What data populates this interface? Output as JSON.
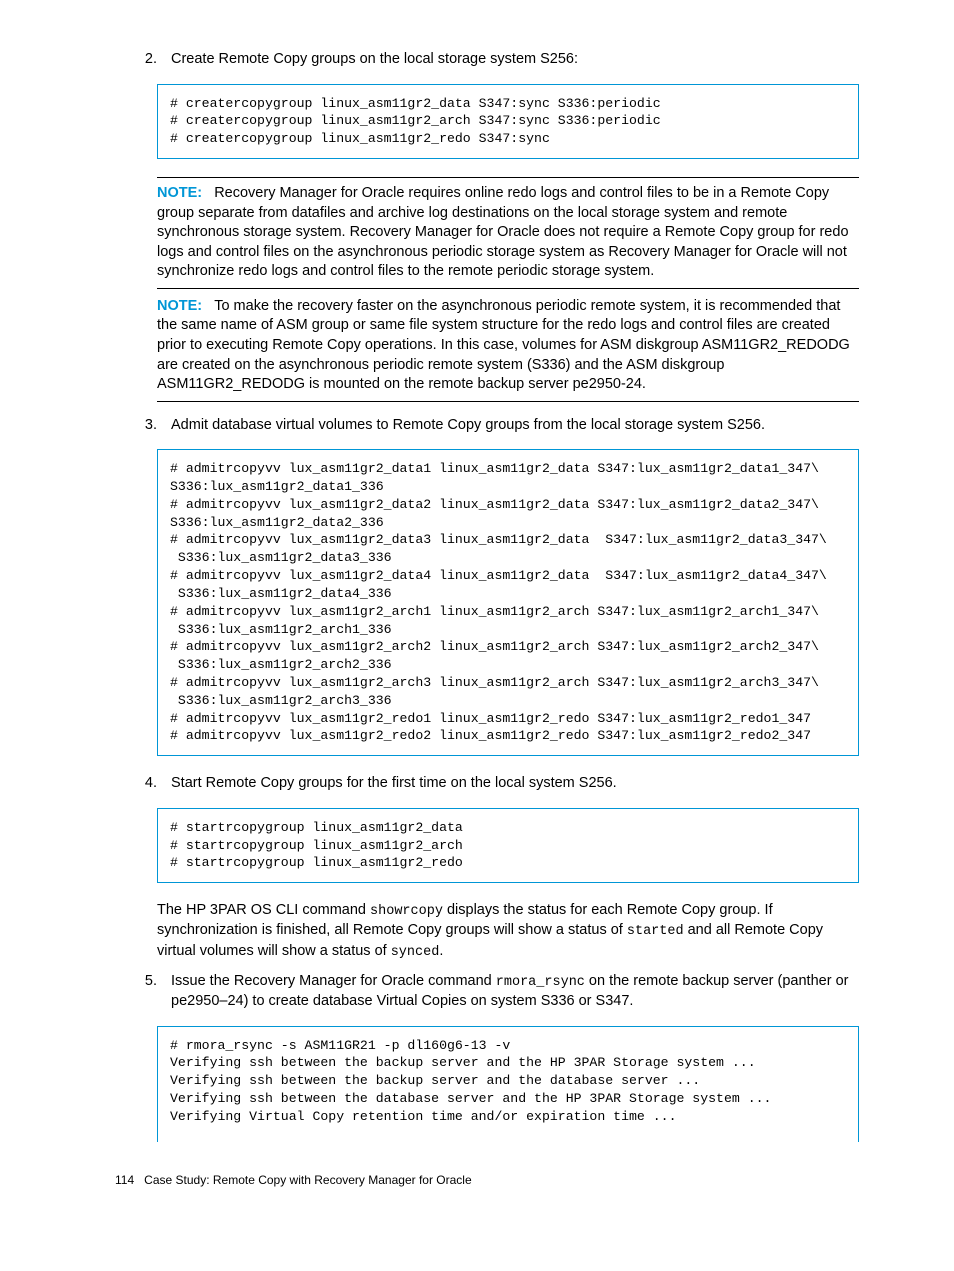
{
  "steps": {
    "s2": {
      "num": "2.",
      "text": "Create Remote Copy groups on the local storage system S256:"
    },
    "s3": {
      "num": "3.",
      "text": "Admit database virtual volumes to Remote Copy groups from the local storage system S256."
    },
    "s4": {
      "num": "4.",
      "text": "Start Remote Copy groups for the first time on the local system S256."
    },
    "s5": {
      "num": "5.",
      "text_a": "Issue the Recovery Manager for Oracle command ",
      "code_a": "rmora_rsync",
      "text_b": " on the remote backup server (panther or pe2950–24) to create database Virtual Copies on system S336 or S347."
    }
  },
  "code1": "# creatercopygroup linux_asm11gr2_data S347:sync S336:periodic\n# creatercopygroup linux_asm11gr2_arch S347:sync S336:periodic\n# creatercopygroup linux_asm11gr2_redo S347:sync",
  "note1": {
    "label": "NOTE:",
    "text": "Recovery Manager for Oracle requires online redo logs and control files to be in a Remote Copy group separate from datafiles and archive log destinations on the local storage system and remote synchronous storage system. Recovery Manager for Oracle does not require a Remote Copy group for redo logs and control files on the asynchronous periodic storage system as Recovery Manager for Oracle will not synchronize redo logs and control files to the remote periodic storage system."
  },
  "note2": {
    "label": "NOTE:",
    "text": "To make the recovery faster on the asynchronous periodic remote system, it is recommended that the same name of ASM group or same file system structure for the redo logs and control files are created prior to executing Remote Copy operations. In this case, volumes for ASM diskgroup ASM11GR2_REDODG are created on the asynchronous periodic remote system (S336) and the ASM diskgroup ASM11GR2_REDODG is mounted on the remote backup server pe2950-24."
  },
  "code2": "# admitrcopyvv lux_asm11gr2_data1 linux_asm11gr2_data S347:lux_asm11gr2_data1_347\\\nS336:lux_asm11gr2_data1_336\n# admitrcopyvv lux_asm11gr2_data2 linux_asm11gr2_data S347:lux_asm11gr2_data2_347\\\nS336:lux_asm11gr2_data2_336\n# admitrcopyvv lux_asm11gr2_data3 linux_asm11gr2_data  S347:lux_asm11gr2_data3_347\\\n S336:lux_asm11gr2_data3_336\n# admitrcopyvv lux_asm11gr2_data4 linux_asm11gr2_data  S347:lux_asm11gr2_data4_347\\\n S336:lux_asm11gr2_data4_336\n# admitrcopyvv lux_asm11gr2_arch1 linux_asm11gr2_arch S347:lux_asm11gr2_arch1_347\\\n S336:lux_asm11gr2_arch1_336\n# admitrcopyvv lux_asm11gr2_arch2 linux_asm11gr2_arch S347:lux_asm11gr2_arch2_347\\\n S336:lux_asm11gr2_arch2_336\n# admitrcopyvv lux_asm11gr2_arch3 linux_asm11gr2_arch S347:lux_asm11gr2_arch3_347\\\n S336:lux_asm11gr2_arch3_336\n# admitrcopyvv lux_asm11gr2_redo1 linux_asm11gr2_redo S347:lux_asm11gr2_redo1_347\n# admitrcopyvv lux_asm11gr2_redo2 linux_asm11gr2_redo S347:lux_asm11gr2_redo2_347",
  "code3": "# startrcopygroup linux_asm11gr2_data\n# startrcopygroup linux_asm11gr2_arch\n# startrcopygroup linux_asm11gr2_redo",
  "para4": {
    "a": "The HP 3PAR OS CLI command ",
    "c1": "showrcopy",
    "b": " displays the status for each Remote Copy group. If synchronization is finished, all Remote Copy groups will show a status of ",
    "c2": "started",
    "c": " and all Remote Copy virtual volumes will show a status of ",
    "c3": "synced",
    "d": "."
  },
  "code4": "# rmora_rsync -s ASM11GR21 -p dl160g6-13 -v\nVerifying ssh between the backup server and the HP 3PAR Storage system ...\nVerifying ssh between the backup server and the database server ...\nVerifying ssh between the database server and the HP 3PAR Storage system ...\nVerifying Virtual Copy retention time and/or expiration time ...",
  "footer": {
    "page": "114",
    "title": "Case Study: Remote Copy with Recovery Manager for Oracle"
  }
}
